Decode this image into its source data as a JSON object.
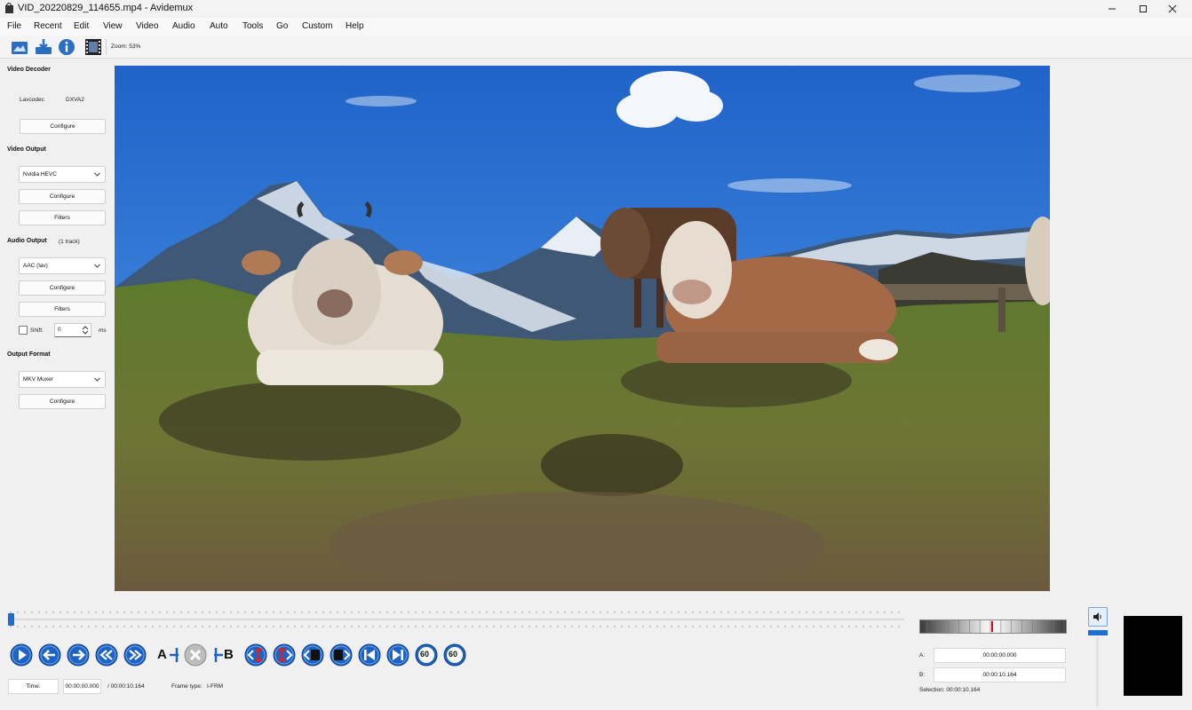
{
  "window": {
    "title": "VID_20220829_114655.mp4 - Avidemux",
    "controls": [
      "minimize-icon",
      "maximize-icon",
      "close-icon"
    ]
  },
  "menu": [
    "File",
    "Recent",
    "Edit",
    "View",
    "Video",
    "Audio",
    "Auto",
    "Tools",
    "Go",
    "Custom",
    "Help"
  ],
  "toolbar": {
    "buttons": [
      "open-video-icon",
      "save-video-icon",
      "properties-info-icon",
      "film-strip-icon"
    ],
    "zoom": "Zoom: 53%"
  },
  "video_decoder": {
    "title": "Video Decoder",
    "codec": "Lavcodec",
    "accel": "DXVA2",
    "configure": "Configure"
  },
  "video_output": {
    "title": "Video Output",
    "codec": "Nvidia HEVC",
    "configure": "Configure",
    "filters": "Filters"
  },
  "audio_output": {
    "title": "Audio Output",
    "tracks": "(1 track)",
    "codec": "AAC (lav)",
    "configure": "Configure",
    "filters": "Filters",
    "shift_label": "Shift:",
    "shift_value": "0",
    "shift_unit": "ms",
    "shift_checked": false
  },
  "output_format": {
    "title": "Output Format",
    "muxer": "MKV Muxer",
    "configure": "Configure"
  },
  "transport": {
    "buttons": [
      "play-icon",
      "previous-frame-icon",
      "next-frame-icon",
      "rewind-icon",
      "fast-forward-icon",
      "set-marker-a-icon",
      "delete-selection-icon",
      "set-marker-b-icon",
      "previous-keyframe-icon",
      "next-keyframe-icon",
      "previous-black-frame-icon",
      "next-black-frame-icon",
      "go-to-start-icon",
      "go-to-end-icon",
      "back-60s-icon",
      "forward-60s-icon"
    ],
    "back_label": "60",
    "fwd_label": "60",
    "marker_a": "A",
    "marker_b": "B"
  },
  "status": {
    "time_label": "Time:",
    "time_value": "00:00:00.000",
    "duration": "/ 00:00:10.164",
    "frame_type_label": "Frame type:",
    "frame_type": "I-FRM"
  },
  "selection": {
    "a_label": "A:",
    "a_value": "00:00:00.000",
    "b_label": "B:",
    "b_value": "00:00:10.164",
    "summary": "Selection: 00:00:10.164"
  },
  "playback_position_fraction": 0.0,
  "colors": {
    "accent": "#1a6fd0",
    "button_blue": "#1e63c4",
    "gauge_marker": "#d01010"
  }
}
